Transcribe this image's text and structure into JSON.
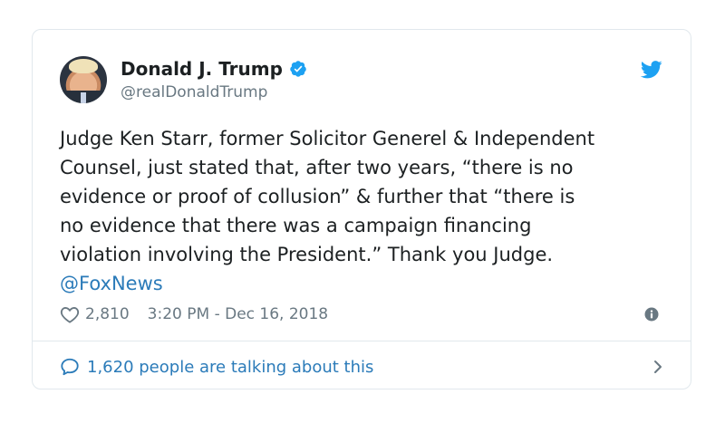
{
  "tweet": {
    "author_name": "Donald J. Trump",
    "handle": "@realDonaldTrump",
    "text_lines": [
      "Judge Ken Starr, former Solicitor Generel & Independent",
      "Counsel, just stated that, after two years, “there is no",
      "evidence or proof of collusion” & further that “there is",
      "no evidence that there was a campaign financing",
      "violation involving the President.” Thank you Judge."
    ],
    "mention": "@FoxNews",
    "like_count": "2,810",
    "timestamp": "3:20 PM - Dec 16, 2018",
    "talking_text": "1,620 people are talking about this"
  },
  "colors": {
    "accent": "#1da1f2",
    "link": "#2b7bb9",
    "meta_text": "#697882",
    "border": "#e1e8ed"
  },
  "icons": {
    "verified": "verified-badge-icon",
    "brand": "twitter-bird-icon",
    "like": "heart-icon",
    "info": "info-icon",
    "reply": "comment-bubble-icon",
    "more": "chevron-right-icon"
  }
}
